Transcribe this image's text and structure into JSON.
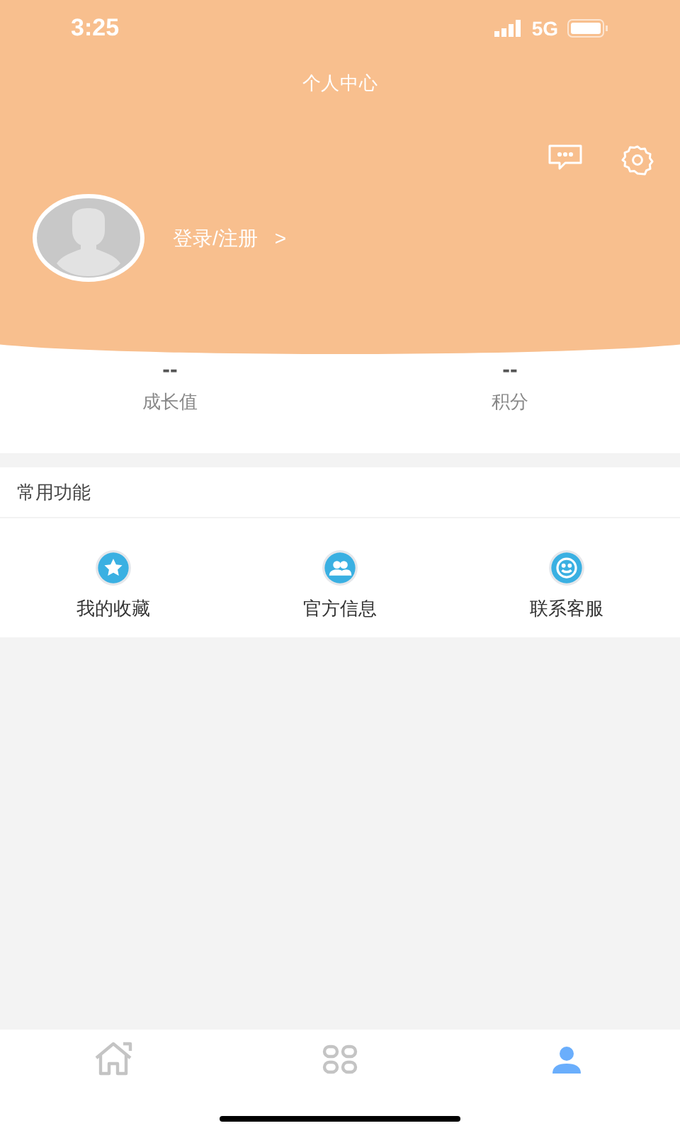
{
  "status_bar": {
    "time": "3:25",
    "network": "5G"
  },
  "header": {
    "title": "个人中心",
    "login": "登录/注册",
    "chevron": ">"
  },
  "stats": [
    {
      "value": "--",
      "label": "成长值"
    },
    {
      "value": "--",
      "label": "积分"
    }
  ],
  "section": {
    "title": "常用功能"
  },
  "features": [
    {
      "kind": "star",
      "label": "我的收藏"
    },
    {
      "kind": "people",
      "label": "官方信息"
    },
    {
      "kind": "smile",
      "label": "联系客服"
    }
  ],
  "tab_bar": [
    {
      "kind": "home",
      "selected": false
    },
    {
      "kind": "grid",
      "selected": false
    },
    {
      "kind": "user",
      "selected": true
    }
  ]
}
